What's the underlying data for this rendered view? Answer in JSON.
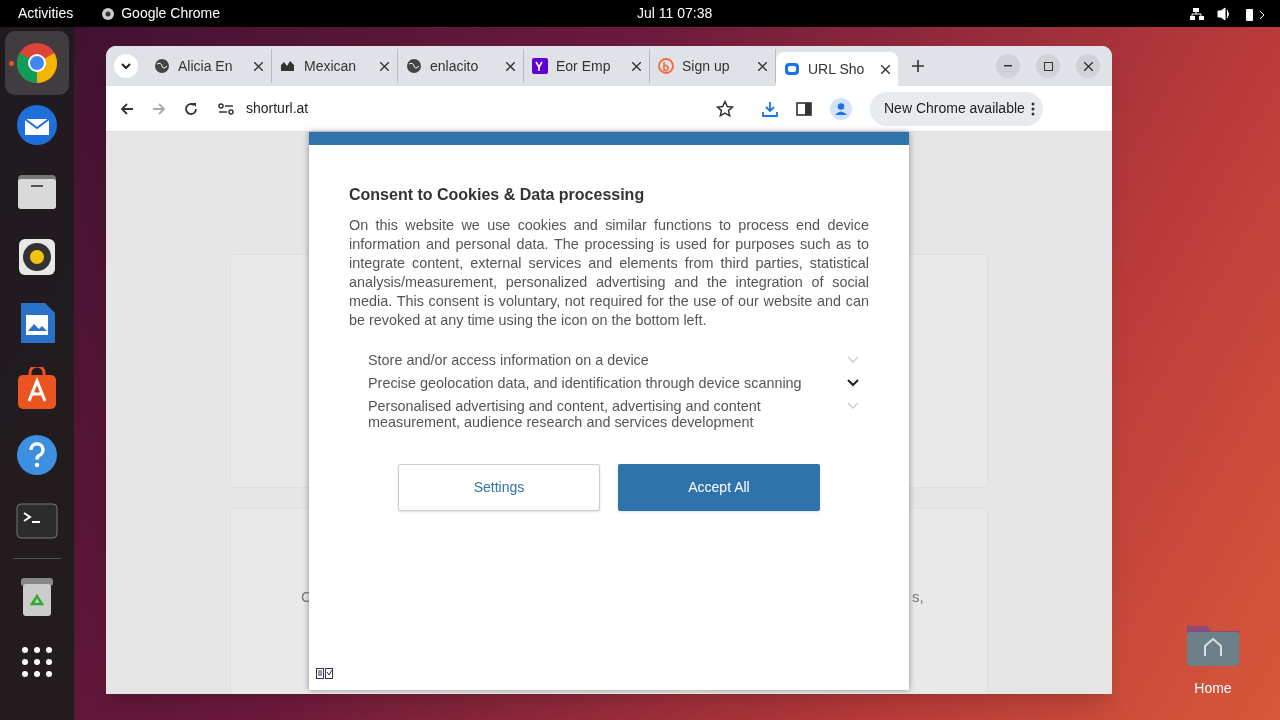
{
  "top_bar": {
    "activities": "Activities",
    "app": "Google Chrome",
    "clock": "Jul 11  07:38"
  },
  "dock": [
    {
      "kind": "browser",
      "running": true
    },
    {
      "kind": "mail",
      "running": false
    },
    {
      "kind": "files",
      "running": false
    },
    {
      "kind": "music",
      "running": false
    },
    {
      "kind": "writer",
      "running": false
    },
    {
      "kind": "store",
      "running": false
    },
    {
      "kind": "help",
      "running": false
    },
    {
      "kind": "terminal",
      "running": false
    },
    {
      "kind": "trash",
      "running": false
    },
    {
      "kind": "apps",
      "running": false
    }
  ],
  "tabs": [
    {
      "title": "Alicia En",
      "kind": "globe",
      "selected": false
    },
    {
      "title": "Mexican",
      "kind": "dark",
      "selected": false
    },
    {
      "title": "enlacito",
      "kind": "globe",
      "selected": false
    },
    {
      "title": "Eor Emp",
      "kind": "yahoo",
      "selected": false
    },
    {
      "title": "Sign up",
      "kind": "orange",
      "selected": false
    },
    {
      "title": "URL Sho",
      "kind": "blue",
      "selected": true
    }
  ],
  "address": "shorturl.at",
  "update_button": "New Chrome available",
  "background_fragments": [
    "C",
    "s,"
  ],
  "consent": {
    "title": "Consent to Cookies & Data processing",
    "body": "On this website we use cookies and similar functions to process end device information and personal data. The processing is used for purposes such as to integrate content, external services and elements from third parties, statistical analysis/measurement, personalized advertising and the integration of social media. This consent is voluntary, not required for the use of our website and can be revoked at any time using the icon on the bottom left.",
    "purposes": [
      {
        "label": "Store and/or access information on a device",
        "active": false
      },
      {
        "label": "Precise geolocation data, and identification through device scanning",
        "active": true
      },
      {
        "label": "Personalised advertising and content, advertising and content measurement, audience research and services development",
        "active": false
      }
    ],
    "settings_button": "Settings",
    "accept_button": "Accept All"
  },
  "desktop_icon": {
    "label": "Home"
  }
}
